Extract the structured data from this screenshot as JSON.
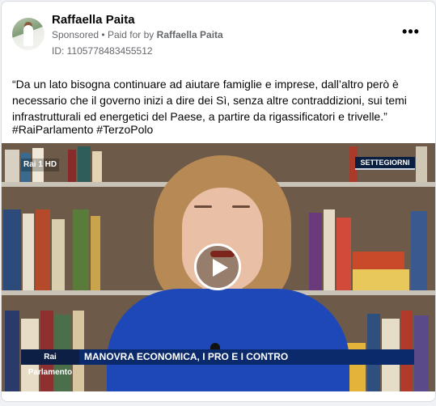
{
  "post": {
    "author": "Raffaella Paita",
    "sponsored_label": "Sponsored",
    "separator": "•",
    "paid_for_prefix": "Paid for by",
    "paid_for_name": "Raffaella Paita",
    "ad_id": "ID: 1105778483455512",
    "more_icon": "more-horizontal-icon",
    "text": "“Da un lato bisogna continuare ad aiutare famiglie e imprese, dall’altro però è necessario che il governo inizi a dire dei Sì, senza altre contraddizioni, sui temi infrastrutturali ed energetici del Paese, a partire da rigassificatori e trivelle.”",
    "hashtags": "#RaiParlamento #TerzoPolo"
  },
  "video": {
    "channel_logo": "Rai 1 HD",
    "program_tag": "SETTEGIORNI",
    "banner_logo": "Rai Parlamento",
    "banner_text": "MANOVRA ECONOMICA, I PRO E I CONTRO",
    "play_icon": "play-icon",
    "colors": {
      "banner": "#0a2a6b",
      "tag": "#0a1f3f",
      "jacket": "#1e48b8"
    }
  }
}
